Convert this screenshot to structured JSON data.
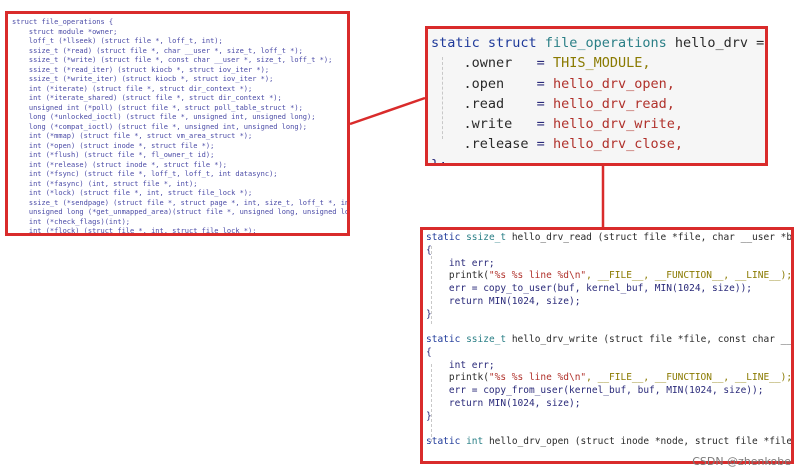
{
  "colors": {
    "border": "#d92b2b",
    "connector": "#d92b2b"
  },
  "left_code": [
    "struct file_operations {",
    "    struct module *owner;",
    "    loff_t (*llseek) (struct file *, loff_t, int);",
    "    ssize_t (*read) (struct file *, char __user *, size_t, loff_t *);",
    "    ssize_t (*write) (struct file *, const char __user *, size_t, loff_t *);",
    "    ssize_t (*read_iter) (struct kiocb *, struct iov_iter *);",
    "    ssize_t (*write_iter) (struct kiocb *, struct iov_iter *);",
    "    int (*iterate) (struct file *, struct dir_context *);",
    "    int (*iterate_shared) (struct file *, struct dir_context *);",
    "    unsigned int (*poll) (struct file *, struct poll_table_struct *);",
    "    long (*unlocked_ioctl) (struct file *, unsigned int, unsigned long);",
    "    long (*compat_ioctl) (struct file *, unsigned int, unsigned long);",
    "    int (*mmap) (struct file *, struct vm_area_struct *);",
    "    int (*open) (struct inode *, struct file *);",
    "    int (*flush) (struct file *, fl_owner_t id);",
    "    int (*release) (struct inode *, struct file *);",
    "    int (*fsync) (struct file *, loff_t, loff_t, int datasync);",
    "    int (*fasync) (int, struct file *, int);",
    "    int (*lock) (struct file *, int, struct file_lock *);",
    "    ssize_t (*sendpage) (struct file *, struct page *, int, size_t, loff_t *, int);",
    "    unsigned long (*get_unmapped_area)(struct file *, unsigned long, unsigned long, unsigned long, unsigned long);",
    "    int (*check_flags)(int);",
    "    int (*flock) (struct file *, int, struct file_lock *);"
  ],
  "top_code": {
    "header_kw": "static struct",
    "header_type": "file_operations",
    "header_name": "hello_drv = {",
    "fields": [
      {
        "name": ".owner",
        "value": "THIS_MODULE,"
      },
      {
        "name": ".open",
        "value": "hello_drv_open,"
      },
      {
        "name": ".read",
        "value": "hello_drv_read,"
      },
      {
        "name": ".write",
        "value": "hello_drv_write,"
      },
      {
        "name": ".release",
        "value": "hello_drv_close,"
      }
    ],
    "closing": "};"
  },
  "bottom_code": [
    {
      "id": "read-sig",
      "kw": "static",
      "ty": "ssize_t",
      "rest": " hello_drv_read (struct file *file, char __user *buf,"
    },
    {
      "id": "brace-open-1",
      "plain": "{"
    },
    {
      "id": "err-decl-1",
      "plain": "    int err;"
    },
    {
      "id": "printk-1",
      "pre": "    printk(",
      "str": "\"%s %s line %d\\n\"",
      "post": ", __FILE__, __FUNCTION__, __LINE__);"
    },
    {
      "id": "copy-to-user",
      "plain": "    err = copy_to_user(buf, kernel_buf, MIN(1024, size));"
    },
    {
      "id": "return-1",
      "plain": "    return MIN(1024, size);"
    },
    {
      "id": "brace-close-1",
      "plain": "}"
    },
    {
      "id": "blank-1",
      "plain": " "
    },
    {
      "id": "write-sig",
      "kw": "static",
      "ty": "ssize_t",
      "rest": " hello_drv_write (struct file *file, const char __use"
    },
    {
      "id": "brace-open-2",
      "plain": "{"
    },
    {
      "id": "err-decl-2",
      "plain": "    int err;"
    },
    {
      "id": "printk-2",
      "pre": "    printk(",
      "str": "\"%s %s line %d\\n\"",
      "post": ", __FILE__, __FUNCTION__, __LINE__);"
    },
    {
      "id": "copy-from-user",
      "plain": "    err = copy_from_user(kernel_buf, buf, MIN(1024, size));"
    },
    {
      "id": "return-2",
      "plain": "    return MIN(1024, size);"
    },
    {
      "id": "brace-close-2",
      "plain": "}"
    },
    {
      "id": "blank-2",
      "plain": " "
    },
    {
      "id": "open-sig",
      "kw": "static",
      "ty": "int",
      "rest": " hello_drv_open (struct inode *node, struct file *file)"
    }
  ],
  "watermark": "CSDN @zhenkobe"
}
